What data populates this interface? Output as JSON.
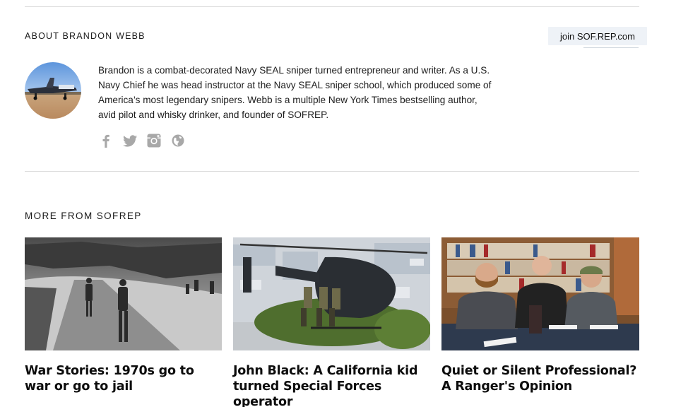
{
  "about": {
    "label": "ABOUT BRANDON WEBB",
    "join_label": "join SOF.REP.com",
    "bio": "Brandon is a combat-decorated Navy SEAL sniper turned entrepreneur and writer. As a U.S. Navy Chief he was head instructor at the Navy SEAL sniper school, which produced some of America’s most legendary snipers. Webb is a multiple New York Times bestselling author, avid pilot and whisky drinker, and founder of SOFREP.",
    "socials": [
      {
        "icon": "facebook-icon"
      },
      {
        "icon": "twitter-icon"
      },
      {
        "icon": "instagram-icon"
      },
      {
        "icon": "globe-icon"
      }
    ]
  },
  "more": {
    "label": "MORE FROM SOFREP",
    "articles": [
      {
        "title": "War Stories: 1970s go to war or go to jail"
      },
      {
        "title": "John Black: A California kid turned Special Forces operator"
      },
      {
        "title": "Quiet or Silent Professional? A Ranger's Opinion"
      }
    ]
  },
  "colors": {
    "rule": "#dcdcdc",
    "join_bg": "#eef2f7",
    "icon": "#a8a8a8"
  }
}
